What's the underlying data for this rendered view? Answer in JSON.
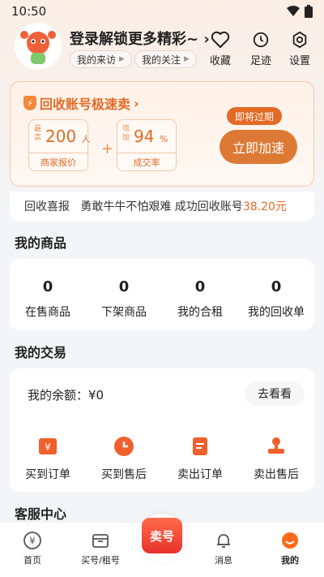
{
  "status_bar": {
    "time": "10:50"
  },
  "header": {
    "title": "登录解锁更多精彩~",
    "visitors_label": "我的来访",
    "following_label": "我的关注",
    "actions": [
      {
        "label": "收藏",
        "icon": "heart-icon"
      },
      {
        "label": "足迹",
        "icon": "history-icon"
      },
      {
        "label": "设置",
        "icon": "gear-icon"
      }
    ]
  },
  "recycle": {
    "title": "回收账号极速卖",
    "stat1": {
      "prefix": "最高",
      "value": "200",
      "unit": "人",
      "caption": "商家报价"
    },
    "stat2": {
      "prefix": "增加",
      "value": "94",
      "unit": "%",
      "caption": "成交率"
    },
    "badge": "即将过期",
    "button": "立即加速"
  },
  "ticker": {
    "label": "回收喜报",
    "text": "勇敢牛牛不怕艰难 成功回收账号",
    "amount": "38.20元"
  },
  "goods": {
    "title": "我的商品",
    "items": [
      {
        "count": "0",
        "label": "在售商品"
      },
      {
        "count": "0",
        "label": "下架商品"
      },
      {
        "count": "0",
        "label": "我的合租"
      },
      {
        "count": "0",
        "label": "我的回收单"
      }
    ]
  },
  "trade": {
    "title": "我的交易",
    "balance": "我的余额：¥0",
    "view_button": "去看看",
    "items": [
      {
        "label": "买到订单",
        "icon": "yen-order-icon"
      },
      {
        "label": "买到售后",
        "icon": "clock-icon"
      },
      {
        "label": "卖出订单",
        "icon": "document-icon"
      },
      {
        "label": "卖出售后",
        "icon": "stamp-icon"
      }
    ]
  },
  "service": {
    "title": "客服中心"
  },
  "tabbar": {
    "home": "首页",
    "buy": "买号/租号",
    "sell": "卖号",
    "messages": "消息",
    "mine": "我的"
  },
  "colors": {
    "accent": "#e36a25",
    "sell": "#e8322c"
  }
}
